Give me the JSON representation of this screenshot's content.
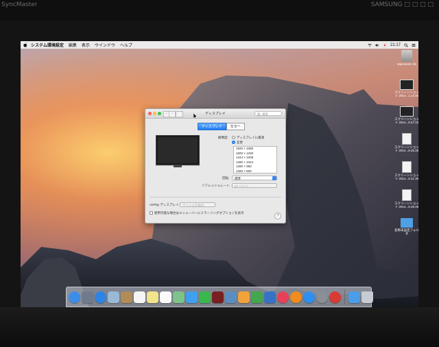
{
  "bezel": {
    "top_left_text": "SyncMaster",
    "top_right_text": "SAMSUNG  □ □ □ □"
  },
  "menubar": {
    "app_name": "システム環境設定",
    "items": [
      "編集",
      "表示",
      "ウインドウ",
      "ヘルプ"
    ],
    "clock": "21:17"
  },
  "desktop": {
    "icons": [
      {
        "label": "Macintosh HD",
        "kind": "drive"
      },
      {
        "label": "スクリーンショット 2014...1.13.05",
        "kind": "screenshot"
      },
      {
        "label": "スクリーンショット 2014...8.27.10",
        "kind": "screenshot"
      },
      {
        "label": "スクリーンショット 2014...8.25.28",
        "kind": "document"
      },
      {
        "label": "スクリーンショット 2014...8.21.30",
        "kind": "document"
      },
      {
        "label": "スクリーンショット 2014...8.25.25",
        "kind": "document"
      },
      {
        "label": "名称未設定フォルダ",
        "kind": "folder"
      }
    ]
  },
  "window": {
    "title": "ディスプレイ",
    "search_placeholder": "検索",
    "tabs": [
      {
        "label": "ディスプレイ",
        "active": true
      },
      {
        "label": "カラー",
        "active": false
      }
    ],
    "resolution_label": "解像度:",
    "resolution_options": [
      {
        "label": "ディスプレイに最適",
        "selected": false
      },
      {
        "label": "変更",
        "selected": true
      }
    ],
    "resolutions": [
      "1920 × 1080",
      "1600 × 1200",
      "1344 × 1008",
      "1280 × 1024",
      "1280 × 960",
      "1280 × 800"
    ],
    "rotation_label": "回転:",
    "rotation_value": "標準",
    "refresh_label": "リフレッシュレート:",
    "refresh_value": "60 ヘルツ",
    "airplay_label": "AirPlay ディスプレイ:",
    "airplay_value": "デバイスを検出",
    "mirror_option": "使用可能な場合はメニューバーにミラーリングオプションを表示",
    "help": "?"
  },
  "dock": {
    "apps": [
      {
        "name": "finder",
        "color": "#3b8ee8"
      },
      {
        "name": "launchpad",
        "color": "#6f7b8c"
      },
      {
        "name": "safari",
        "color": "#2f84e3"
      },
      {
        "name": "mail",
        "color": "#9ab9d6"
      },
      {
        "name": "contacts",
        "color": "#b38b57"
      },
      {
        "name": "calendar",
        "color": "#f5f5f5"
      },
      {
        "name": "notes",
        "color": "#f3e38a"
      },
      {
        "name": "reminders",
        "color": "#fafafa"
      },
      {
        "name": "maps",
        "color": "#7cc48a"
      },
      {
        "name": "messages",
        "color": "#3fa0f0"
      },
      {
        "name": "facetime",
        "color": "#38b84d"
      },
      {
        "name": "photo-booth",
        "color": "#7a1f1f"
      },
      {
        "name": "iphoto",
        "color": "#5a8ec2"
      },
      {
        "name": "pages",
        "color": "#f1a33b"
      },
      {
        "name": "numbers",
        "color": "#41a84d"
      },
      {
        "name": "keynote",
        "color": "#3673c6"
      },
      {
        "name": "itunes",
        "color": "#e8405a"
      },
      {
        "name": "ibooks",
        "color": "#f28c1e"
      },
      {
        "name": "app-store",
        "color": "#2d8ff0"
      },
      {
        "name": "system-preferences",
        "color": "#8a8f96"
      },
      {
        "name": "davinci",
        "color": "#d83a34"
      }
    ],
    "stack_color": "#4c9de8",
    "trash_color": "#c7ccd3"
  }
}
